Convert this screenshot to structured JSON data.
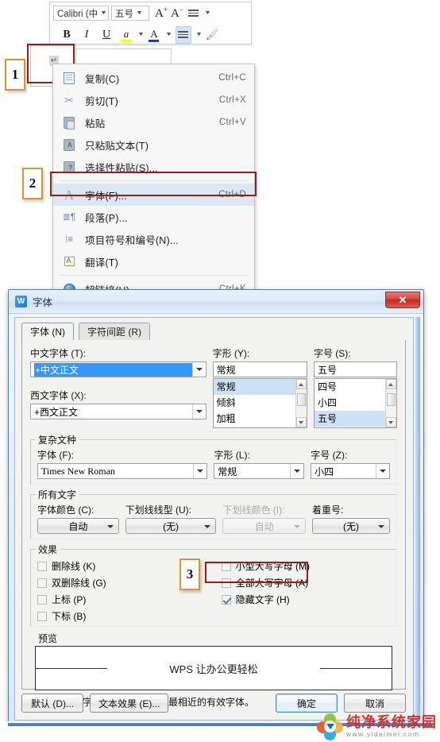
{
  "toolbar": {
    "font_name": "Calibri (中",
    "font_size": "五号",
    "grow_font": "A",
    "shrink_font": "A",
    "line_spacing": "line-spacing",
    "bold": "B",
    "italic": "I",
    "underline": "U",
    "highlight": "a",
    "font_color": "A",
    "align": "align",
    "format_painter": "format-painter"
  },
  "context_menu": {
    "items": [
      {
        "icon": "copy-icon",
        "label": "复制(C)",
        "accel": "Ctrl+C",
        "highlight": false
      },
      {
        "icon": "cut-icon",
        "label": "剪切(T)",
        "accel": "Ctrl+X",
        "highlight": false
      },
      {
        "icon": "paste-icon",
        "label": "粘贴",
        "accel": "Ctrl+V",
        "highlight": false
      },
      {
        "icon": "paste-text-only-icon",
        "label": "只粘贴文本(T)",
        "accel": "",
        "highlight": false
      },
      {
        "icon": "paste-special-icon",
        "label": "选择性粘贴(S)...",
        "accel": "",
        "highlight": false
      },
      {
        "icon": "font-icon",
        "label": "字体(F)...",
        "accel": "Ctrl+D",
        "highlight": true
      },
      {
        "icon": "paragraph-icon",
        "label": "段落(P)...",
        "accel": "",
        "highlight": false
      },
      {
        "icon": "bullets-numbering-icon",
        "label": "项目符号和编号(N)...",
        "accel": "",
        "highlight": false
      },
      {
        "icon": "translate-icon",
        "label": "翻译(T)",
        "accel": "",
        "highlight": false
      },
      {
        "icon": "hyperlink-icon",
        "label": "超链接(H)...",
        "accel": "Ctrl+K",
        "highlight": false
      }
    ]
  },
  "markers": {
    "one": "1",
    "two": "2",
    "three": "3"
  },
  "dialog": {
    "title": "字体",
    "close_label": "✕",
    "tabs": [
      {
        "label": "字体 (N)",
        "active": true
      },
      {
        "label": "字符间距 (R)",
        "active": false
      }
    ],
    "latin_section": {
      "cn_font_label": "中文字体 (T):",
      "cn_font_value": "+中文正文",
      "en_font_label": "西文字体 (X):",
      "en_font_value": "+西文正文",
      "style_label": "字形 (Y):",
      "style_value": "常规",
      "style_options": [
        "常规",
        "倾斜",
        "加粗"
      ],
      "style_selected_index": 0,
      "size_label": "字号 (S):",
      "size_value": "五号",
      "size_options": [
        "四号",
        "小四",
        "五号"
      ],
      "size_selected_index": 2
    },
    "complex_section": {
      "title": "复杂文种",
      "font_label": "字体 (F):",
      "font_value": "Times New Roman",
      "style_label": "字形 (L):",
      "style_value": "常规",
      "size_label": "字号 (Z):",
      "size_value": "小四"
    },
    "all_text_section": {
      "title": "所有文字",
      "color_label": "字体颜色 (C):",
      "color_value": "自动",
      "underline_style_label": "下划线线型 (U):",
      "underline_style_value": "(无)",
      "underline_color_label": "下划线颜色 (I):",
      "underline_color_value": "自动",
      "underline_color_disabled": true,
      "emphasis_label": "着重号:",
      "emphasis_value": "(无)"
    },
    "effects_section": {
      "title": "效果",
      "left": [
        {
          "label": "删除线 (K)",
          "checked": false
        },
        {
          "label": "双删除线 (G)",
          "checked": false
        },
        {
          "label": "上标 (P)",
          "checked": false
        },
        {
          "label": "下标 (B)",
          "checked": false
        }
      ],
      "right": [
        {
          "label": "小型大写字母 (M)",
          "checked": false
        },
        {
          "label": "全部大写字母 (A)",
          "checked": false
        },
        {
          "label": "隐藏文字 (H)",
          "checked": true
        }
      ]
    },
    "preview_section": {
      "title": "预览",
      "text": "WPS 让办公更轻松",
      "note": "尚未安装此字体，打印时将采用最相近的有效字体。"
    },
    "footer": {
      "default_button": "默认 (D)...",
      "text_effects_button": "文本效果 (E)...",
      "ok_button": "确定",
      "cancel_button": "取消"
    }
  },
  "watermark": {
    "name": "纯净系统家园",
    "url": "www.yidaimei.com"
  },
  "colors": {
    "callout_red": "#9c1b17",
    "marker_orange": "#d8962c",
    "menu_highlight": "#dce7f5",
    "selection_blue": "#3399ff",
    "list_selection": "#cde0f5"
  }
}
